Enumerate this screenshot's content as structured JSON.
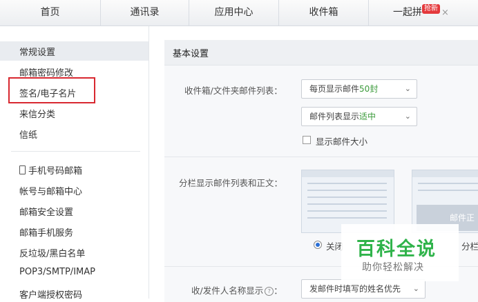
{
  "tabs": [
    {
      "label": "首页"
    },
    {
      "label": "通讯录"
    },
    {
      "label": "应用中心"
    },
    {
      "label": "收件箱"
    },
    {
      "label": "一起拼",
      "badge": "抢新",
      "close": "×"
    }
  ],
  "sidebar": {
    "items": [
      {
        "label": "常规设置",
        "active": true
      },
      {
        "label": "邮箱密码修改"
      },
      {
        "label": "签名/电子名片",
        "highlighted": true
      },
      {
        "label": "来信分类"
      },
      {
        "label": "信纸"
      },
      {
        "label": "手机号码邮箱"
      },
      {
        "label": "帐号与邮箱中心"
      },
      {
        "label": "邮箱安全设置"
      },
      {
        "label": "邮箱手机服务"
      },
      {
        "label": "反垃圾/黑白名单"
      },
      {
        "label": "POP3/SMTP/IMAP"
      },
      {
        "label": "客户端授权密码"
      }
    ]
  },
  "settings": {
    "title": "基本设置",
    "list_label": "收件箱/文件夹邮件列表：",
    "per_page_prefix": "每页显示邮件",
    "per_page_value": "50封",
    "density_prefix": "邮件列表显示",
    "density_value": "适中",
    "show_size_label": "显示邮件大小",
    "split_label": "分栏显示邮件列表和正文：",
    "split_option_off": "关闭",
    "split_option_right": "分栏",
    "split_preview_text": "邮件正",
    "name_display_label": "收/发件人名称显示",
    "name_display_value": "发邮件时填写的姓名优先"
  },
  "watermark": {
    "title": "百科全说",
    "subtitle": "助你轻松解决"
  },
  "colors": {
    "accent_green": "#3a9a3a",
    "highlight_red": "#d8272f",
    "brand_green": "#2fb34a"
  }
}
